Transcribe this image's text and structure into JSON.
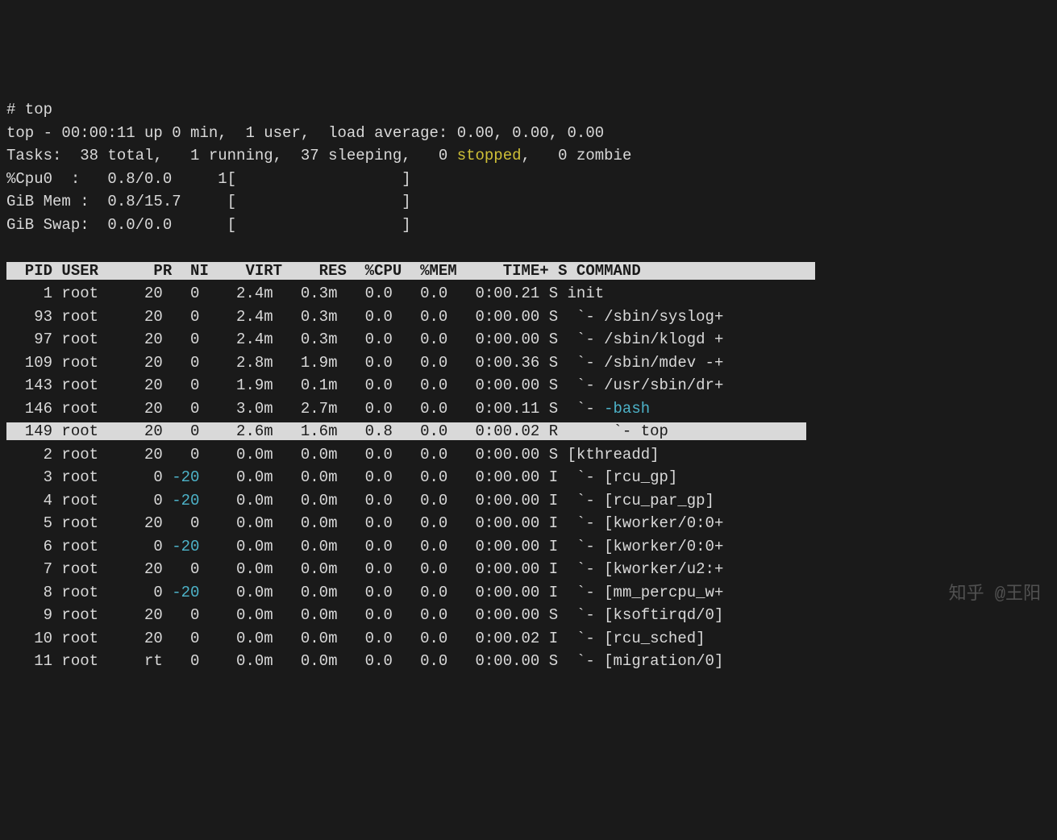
{
  "prompt": "# top",
  "summary": {
    "line1_pre": "top - 00:00:11 up 0 min,  1 user,  load average: 0.00, 0.00, 0.00",
    "tasks_pre": "Tasks:  38 total,   1 running,  37 sleeping,   0 ",
    "tasks_stopped": "stopped",
    "tasks_post": ",   0 zombie",
    "cpu": "%Cpu0  :   0.8/0.0     1[                  ]",
    "mem": "GiB Mem :  0.8/15.7     [                  ]",
    "swap": "GiB Swap:  0.0/0.0      [                  ]"
  },
  "header": "  PID USER      PR  NI    VIRT    RES  %CPU  %MEM     TIME+ S COMMAND                   ",
  "rows": [
    {
      "pid": "1",
      "user": "root",
      "pr": "20",
      "ni": "0",
      "virt": "2.4m",
      "res": "0.3m",
      "cpu": "0.0",
      "mem": "0.0",
      "time": "0:00.21",
      "s": "S",
      "cmd": "init",
      "tree": "",
      "hl": false,
      "niColor": false,
      "cmdColor": false
    },
    {
      "pid": "93",
      "user": "root",
      "pr": "20",
      "ni": "0",
      "virt": "2.4m",
      "res": "0.3m",
      "cpu": "0.0",
      "mem": "0.0",
      "time": "0:00.00",
      "s": "S",
      "cmd": "/sbin/syslog+",
      "tree": " `- ",
      "hl": false,
      "niColor": false,
      "cmdColor": false
    },
    {
      "pid": "97",
      "user": "root",
      "pr": "20",
      "ni": "0",
      "virt": "2.4m",
      "res": "0.3m",
      "cpu": "0.0",
      "mem": "0.0",
      "time": "0:00.00",
      "s": "S",
      "cmd": "/sbin/klogd +",
      "tree": " `- ",
      "hl": false,
      "niColor": false,
      "cmdColor": false
    },
    {
      "pid": "109",
      "user": "root",
      "pr": "20",
      "ni": "0",
      "virt": "2.8m",
      "res": "1.9m",
      "cpu": "0.0",
      "mem": "0.0",
      "time": "0:00.36",
      "s": "S",
      "cmd": "/sbin/mdev -+",
      "tree": " `- ",
      "hl": false,
      "niColor": false,
      "cmdColor": false
    },
    {
      "pid": "143",
      "user": "root",
      "pr": "20",
      "ni": "0",
      "virt": "1.9m",
      "res": "0.1m",
      "cpu": "0.0",
      "mem": "0.0",
      "time": "0:00.00",
      "s": "S",
      "cmd": "/usr/sbin/dr+",
      "tree": " `- ",
      "hl": false,
      "niColor": false,
      "cmdColor": false
    },
    {
      "pid": "146",
      "user": "root",
      "pr": "20",
      "ni": "0",
      "virt": "3.0m",
      "res": "2.7m",
      "cpu": "0.0",
      "mem": "0.0",
      "time": "0:00.11",
      "s": "S",
      "cmd": "-bash",
      "tree": " `- ",
      "hl": false,
      "niColor": false,
      "cmdColor": true
    },
    {
      "pid": "149",
      "user": "root",
      "pr": "20",
      "ni": "0",
      "virt": "2.6m",
      "res": "1.6m",
      "cpu": "0.8",
      "mem": "0.0",
      "time": "0:00.02",
      "s": "R",
      "cmd": "top",
      "tree": "     `- ",
      "hl": true,
      "niColor": false,
      "cmdColor": false
    },
    {
      "pid": "2",
      "user": "root",
      "pr": "20",
      "ni": "0",
      "virt": "0.0m",
      "res": "0.0m",
      "cpu": "0.0",
      "mem": "0.0",
      "time": "0:00.00",
      "s": "S",
      "cmd": "[kthreadd]",
      "tree": "",
      "hl": false,
      "niColor": false,
      "cmdColor": false
    },
    {
      "pid": "3",
      "user": "root",
      "pr": "0",
      "ni": "-20",
      "virt": "0.0m",
      "res": "0.0m",
      "cpu": "0.0",
      "mem": "0.0",
      "time": "0:00.00",
      "s": "I",
      "cmd": "[rcu_gp]",
      "tree": " `- ",
      "hl": false,
      "niColor": true,
      "cmdColor": false
    },
    {
      "pid": "4",
      "user": "root",
      "pr": "0",
      "ni": "-20",
      "virt": "0.0m",
      "res": "0.0m",
      "cpu": "0.0",
      "mem": "0.0",
      "time": "0:00.00",
      "s": "I",
      "cmd": "[rcu_par_gp]",
      "tree": " `- ",
      "hl": false,
      "niColor": true,
      "cmdColor": false
    },
    {
      "pid": "5",
      "user": "root",
      "pr": "20",
      "ni": "0",
      "virt": "0.0m",
      "res": "0.0m",
      "cpu": "0.0",
      "mem": "0.0",
      "time": "0:00.00",
      "s": "I",
      "cmd": "[kworker/0:0+",
      "tree": " `- ",
      "hl": false,
      "niColor": false,
      "cmdColor": false
    },
    {
      "pid": "6",
      "user": "root",
      "pr": "0",
      "ni": "-20",
      "virt": "0.0m",
      "res": "0.0m",
      "cpu": "0.0",
      "mem": "0.0",
      "time": "0:00.00",
      "s": "I",
      "cmd": "[kworker/0:0+",
      "tree": " `- ",
      "hl": false,
      "niColor": true,
      "cmdColor": false
    },
    {
      "pid": "7",
      "user": "root",
      "pr": "20",
      "ni": "0",
      "virt": "0.0m",
      "res": "0.0m",
      "cpu": "0.0",
      "mem": "0.0",
      "time": "0:00.00",
      "s": "I",
      "cmd": "[kworker/u2:+",
      "tree": " `- ",
      "hl": false,
      "niColor": false,
      "cmdColor": false
    },
    {
      "pid": "8",
      "user": "root",
      "pr": "0",
      "ni": "-20",
      "virt": "0.0m",
      "res": "0.0m",
      "cpu": "0.0",
      "mem": "0.0",
      "time": "0:00.00",
      "s": "I",
      "cmd": "[mm_percpu_w+",
      "tree": " `- ",
      "hl": false,
      "niColor": true,
      "cmdColor": false
    },
    {
      "pid": "9",
      "user": "root",
      "pr": "20",
      "ni": "0",
      "virt": "0.0m",
      "res": "0.0m",
      "cpu": "0.0",
      "mem": "0.0",
      "time": "0:00.00",
      "s": "S",
      "cmd": "[ksoftirqd/0]",
      "tree": " `- ",
      "hl": false,
      "niColor": false,
      "cmdColor": false
    },
    {
      "pid": "10",
      "user": "root",
      "pr": "20",
      "ni": "0",
      "virt": "0.0m",
      "res": "0.0m",
      "cpu": "0.0",
      "mem": "0.0",
      "time": "0:00.02",
      "s": "I",
      "cmd": "[rcu_sched]",
      "tree": " `- ",
      "hl": false,
      "niColor": false,
      "cmdColor": false
    },
    {
      "pid": "11",
      "user": "root",
      "pr": "rt",
      "ni": "0",
      "virt": "0.0m",
      "res": "0.0m",
      "cpu": "0.0",
      "mem": "0.0",
      "time": "0:00.00",
      "s": "S",
      "cmd": "[migration/0]",
      "tree": " `- ",
      "hl": false,
      "niColor": false,
      "cmdColor": false
    }
  ],
  "watermark": "知乎 @王阳"
}
